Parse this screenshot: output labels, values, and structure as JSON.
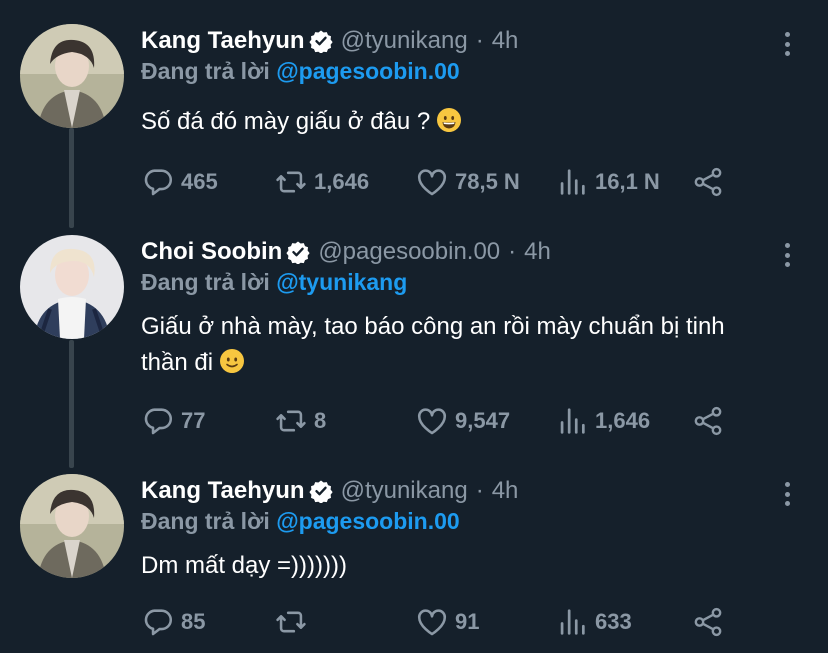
{
  "thread": [
    {
      "name": "Kang Taehyun",
      "handle": "@tyunikang",
      "separator": "·",
      "time": "4h",
      "reply_label": "Đang trả lời",
      "reply_to": "@pagesoobin.00",
      "text": "Số đá đó mày giấu ở đâu ?",
      "emoji": "grinning-face",
      "replies": "465",
      "retweets": "1,646",
      "likes": "78,5 N",
      "views": "16,1 N"
    },
    {
      "name": "Choi Soobin",
      "handle": "@pagesoobin.00",
      "separator": "·",
      "time": "4h",
      "reply_label": "Đang trả lời",
      "reply_to": "@tyunikang",
      "text_line1": "Giấu ở nhà mày, tao báo công an rồi mày chuẩn bị tinh",
      "text_line2": "thần đi",
      "emoji": "slightly-smiling-face",
      "replies": "77",
      "retweets": "8",
      "likes": "9,547",
      "views": "1,646"
    },
    {
      "name": "Kang Taehyun",
      "handle": "@tyunikang",
      "separator": "·",
      "time": "4h",
      "reply_label": "Đang trả lời",
      "reply_to": "@pagesoobin.00",
      "text": "Dm mất dạy =)))))))",
      "replies": "85",
      "retweets": "",
      "likes": "91",
      "views": "633"
    }
  ],
  "colors": {
    "background": "#15202b",
    "secondary_text": "#8b98a5",
    "accent": "#1d9bf0",
    "thread_line": "#38444d"
  }
}
